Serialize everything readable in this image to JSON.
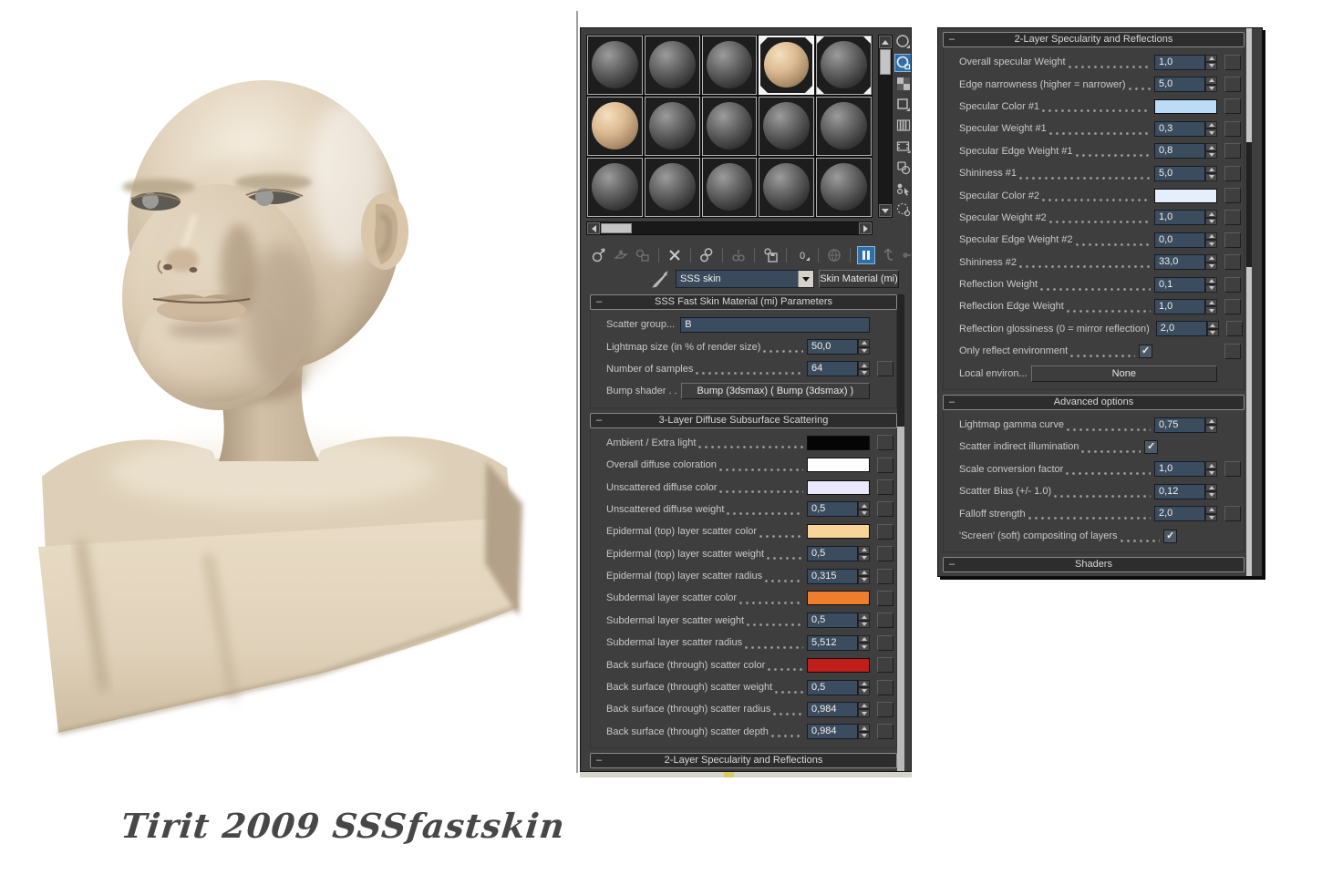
{
  "signature": {
    "text": "Tirit 2009 SSSfastskin"
  },
  "colors": {
    "accent_blue": "#2f6ea6",
    "panel_bg": "#3e3e3e",
    "field_bg": "#3b4c5e",
    "dropdown_bg": "#3a4a5c",
    "skin_sphere": "#dcbb92"
  },
  "material_editor": {
    "name_dropdown": {
      "value": "SSS skin"
    },
    "type_button": {
      "label": "Skin Material (mi)"
    },
    "picker_icon": "eyedropper-icon",
    "slots": {
      "rows": 3,
      "cols": 5,
      "skin_indices": [
        3,
        5
      ],
      "selected_index": 3,
      "assigned_indices": [
        3,
        4
      ]
    },
    "main_toolbar": [
      {
        "name": "get-material",
        "enabled": true
      },
      {
        "name": "put-material-to-scene",
        "enabled": false
      },
      {
        "name": "assign-material-to-selection",
        "enabled": false
      },
      {
        "name": "reset-map-mtl",
        "enabled": true
      },
      {
        "name": "make-material-copy",
        "enabled": true
      },
      {
        "name": "make-unique",
        "enabled": false
      },
      {
        "name": "put-to-library",
        "enabled": true
      },
      {
        "name": "material-id-channel",
        "enabled": true,
        "label": "0"
      },
      {
        "name": "show-map-in-viewport",
        "enabled": false
      },
      {
        "name": "show-end-result",
        "enabled": true,
        "active": true
      },
      {
        "name": "go-to-parent",
        "enabled": false
      },
      {
        "name": "go-forward-to-sibling",
        "enabled": false
      }
    ],
    "side_toolbar": [
      {
        "name": "sample-type",
        "enabled": true
      },
      {
        "name": "backlight",
        "enabled": true,
        "active": true
      },
      {
        "name": "background",
        "enabled": true
      },
      {
        "name": "sample-uv-tiling",
        "enabled": true
      },
      {
        "name": "video-color-check",
        "enabled": true
      },
      {
        "name": "make-preview",
        "enabled": true
      },
      {
        "name": "options",
        "enabled": true
      },
      {
        "name": "select-by-material",
        "enabled": true
      },
      {
        "name": "material-map-navigator",
        "enabled": true
      }
    ]
  },
  "main_rollouts": [
    {
      "name": "sss-fast-skin-parameters",
      "title": "SSS Fast Skin Material (mi) Parameters",
      "rows": [
        {
          "type": "wide",
          "name": "scatter-group",
          "label": "Scatter group...",
          "value": "B"
        },
        {
          "type": "field",
          "name": "lightmap-size",
          "label": "Lightmap size (in % of render size)",
          "value": "50,0",
          "map": false
        },
        {
          "type": "field",
          "name": "number-of-samples",
          "label": "Number of samples",
          "value": "64",
          "map": true
        },
        {
          "type": "button",
          "name": "bump-shader",
          "label": "Bump shader . .",
          "button": "Bump (3dsmax)  ( Bump (3dsmax) )"
        }
      ]
    },
    {
      "name": "three-layer-diffuse-sss",
      "title": "3-Layer Diffuse Subsurface Scattering",
      "rows": [
        {
          "type": "color",
          "name": "ambient-extra-light",
          "label": "Ambient / Extra light",
          "swatch": "#050505",
          "map": true
        },
        {
          "type": "color",
          "name": "overall-diffuse-coloration",
          "label": "Overall diffuse coloration",
          "swatch": "#ffffff",
          "map": true
        },
        {
          "type": "color",
          "name": "unscattered-diffuse-color",
          "label": "Unscattered diffuse color",
          "swatch": "#eae8fa",
          "map": true
        },
        {
          "type": "field",
          "name": "unscattered-diffuse-weight",
          "label": "Unscattered diffuse weight",
          "value": "0,5",
          "map": true
        },
        {
          "type": "color",
          "name": "epidermal-scatter-color",
          "label": "Epidermal (top) layer scatter color",
          "swatch": "#f8d49b",
          "map": true
        },
        {
          "type": "field",
          "name": "epidermal-scatter-weight",
          "label": "Epidermal (top) layer scatter weight",
          "value": "0,5",
          "map": true
        },
        {
          "type": "field",
          "name": "epidermal-scatter-radius",
          "label": "Epidermal (top) layer scatter radius",
          "value": "0,315",
          "map": true
        },
        {
          "type": "color",
          "name": "subdermal-scatter-color",
          "label": "Subdermal layer scatter color",
          "swatch": "#ee7e2c",
          "map": true
        },
        {
          "type": "field",
          "name": "subdermal-scatter-weight",
          "label": "Subdermal layer scatter weight",
          "value": "0,5",
          "map": true
        },
        {
          "type": "field",
          "name": "subdermal-scatter-radius",
          "label": "Subdermal layer scatter radius",
          "value": "5,512",
          "map": true
        },
        {
          "type": "color",
          "name": "back-scatter-color",
          "label": "Back surface (through) scatter color",
          "swatch": "#bf1e1b",
          "map": true
        },
        {
          "type": "field",
          "name": "back-scatter-weight",
          "label": "Back surface (through) scatter weight",
          "value": "0,5",
          "map": true
        },
        {
          "type": "field",
          "name": "back-scatter-radius",
          "label": "Back surface (through) scatter radius",
          "value": "0,984",
          "map": true
        },
        {
          "type": "field",
          "name": "back-scatter-depth",
          "label": "Back surface (through) scatter depth",
          "value": "0,984",
          "map": true
        }
      ]
    },
    {
      "name": "two-layer-specularity-bottom",
      "title": "2-Layer Specularity and Reflections",
      "rows": []
    }
  ],
  "right_rollouts": [
    {
      "name": "two-layer-specularity",
      "title": "2-Layer Specularity and Reflections",
      "rows": [
        {
          "type": "field",
          "name": "overall-specular-weight",
          "label": "Overall specular Weight",
          "value": "1,0",
          "map": true
        },
        {
          "type": "field",
          "name": "edge-narrowness",
          "label": "Edge narrowness (higher = narrower)",
          "value": "5,0",
          "map": true
        },
        {
          "type": "color",
          "name": "specular-color-1",
          "label": "Specular Color #1",
          "swatch": "#badcf7",
          "map": true
        },
        {
          "type": "field",
          "name": "specular-weight-1",
          "label": "Specular Weight #1",
          "value": "0,3",
          "map": true
        },
        {
          "type": "field",
          "name": "specular-edge-weight-1",
          "label": "Specular Edge Weight #1",
          "value": "0,8",
          "map": true
        },
        {
          "type": "field",
          "name": "shininess-1",
          "label": "Shininess #1",
          "value": "5,0",
          "map": true
        },
        {
          "type": "color",
          "name": "specular-color-2",
          "label": "Specular Color #2",
          "swatch": "#e4effb",
          "map": true
        },
        {
          "type": "field",
          "name": "specular-weight-2",
          "label": "Specular Weight #2",
          "value": "1,0",
          "map": true
        },
        {
          "type": "field",
          "name": "specular-edge-weight-2",
          "label": "Specular Edge Weight #2",
          "value": "0,0",
          "map": true
        },
        {
          "type": "field",
          "name": "shininess-2",
          "label": "Shininess #2",
          "value": "33,0",
          "map": true
        },
        {
          "type": "field",
          "name": "reflection-weight",
          "label": "Reflection Weight",
          "value": "0,1",
          "map": true
        },
        {
          "type": "field",
          "name": "reflection-edge-weight",
          "label": "Reflection Edge Weight",
          "value": "1,0",
          "map": true
        },
        {
          "type": "field",
          "name": "reflection-glossiness",
          "label": "Reflection glossiness (0 = mirror reflection)",
          "value": "2,0",
          "map": true
        },
        {
          "type": "check",
          "name": "only-reflect-environment",
          "label": "Only reflect environment",
          "checked": true,
          "map": true
        },
        {
          "type": "button",
          "name": "local-environ",
          "label": "Local environ...",
          "button": "None"
        }
      ]
    },
    {
      "name": "advanced-options",
      "title": "Advanced options",
      "rows": [
        {
          "type": "field",
          "name": "lightmap-gamma-curve",
          "label": "Lightmap gamma curve",
          "value": "0,75",
          "map": false
        },
        {
          "type": "check",
          "name": "scatter-indirect-illumination",
          "label": "Scatter indirect illumination",
          "checked": true,
          "map": false
        },
        {
          "type": "field",
          "name": "scale-conversion-factor",
          "label": "Scale conversion factor",
          "value": "1,0",
          "map": true
        },
        {
          "type": "field",
          "name": "scatter-bias",
          "label": "Scatter Bias (+/- 1.0)",
          "value": "0,12",
          "map": false
        },
        {
          "type": "field",
          "name": "falloff-strength",
          "label": "Falloff strength",
          "value": "2,0",
          "map": true
        },
        {
          "type": "check",
          "name": "screen-compositing",
          "label": "'Screen' (soft) compositing of layers",
          "checked": true,
          "map": false
        }
      ]
    },
    {
      "name": "shaders",
      "title": "Shaders",
      "rows": []
    }
  ]
}
